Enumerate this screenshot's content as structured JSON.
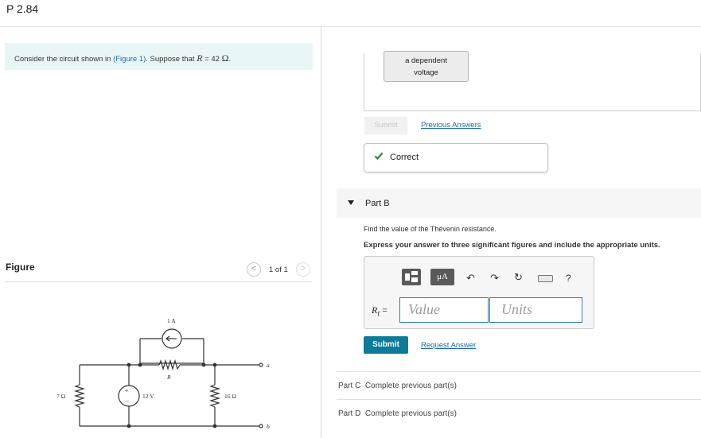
{
  "title": "P 2.84",
  "problem": {
    "prefix": "Consider the circuit shown in ",
    "figure_link": "(Figure 1)",
    "mid": ". Suppose that ",
    "var": "R",
    "equals": " = 42 ",
    "unit": "Ω",
    "end": "."
  },
  "figure": {
    "label": "Figure",
    "count": "1 of 1",
    "prev_icon": "<",
    "next_icon": ">",
    "circuit": {
      "current_source": "1 A",
      "resistor_r": "R",
      "resistor_left": "7 Ω",
      "voltage_source": "12 V",
      "resistor_right": "16 Ω",
      "terminal_a": "a",
      "terminal_b": "b",
      "plus": "+",
      "minus": "−"
    }
  },
  "part_a": {
    "selected_option": [
      "a dependent",
      "voltage"
    ],
    "submit_label": "Submit",
    "previous_answers": "Previous Answers",
    "correct_text": "Correct",
    "check_icon": "check-icon",
    "success_color": "#2e8b2e"
  },
  "part_b": {
    "title": "Part B",
    "question": "Find the value of the Thévenin resistance.",
    "instruction": "Express your answer to three significant figures and include the appropriate units.",
    "toolbar": {
      "units_label": "μA",
      "undo": "↶",
      "redo": "↷",
      "reset": "↻",
      "help": "?"
    },
    "rt_symbol": "R",
    "rt_sub": "t",
    "rt_eq": " =",
    "value_placeholder": "Value",
    "units_placeholder": "Units",
    "submit_label": "Submit",
    "request_answer": "Request Answer",
    "accent_color": "#0c7b99"
  },
  "part_c": {
    "label": "Part C",
    "status": "Complete previous part(s)"
  },
  "part_d": {
    "label": "Part D",
    "status": "Complete previous part(s)"
  }
}
